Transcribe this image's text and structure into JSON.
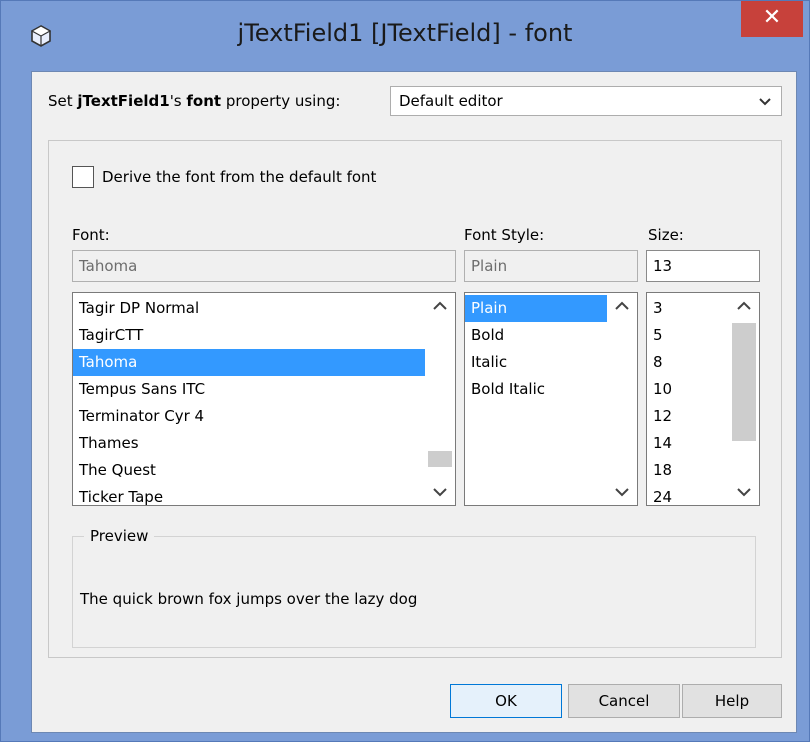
{
  "window": {
    "title": "jTextField1 [JTextField] - font",
    "close_glyph": "✕"
  },
  "property_row": {
    "prefix": "Set ",
    "component": "jTextField1",
    "apostrophe": "'s ",
    "property": "font",
    "suffix": " property using:",
    "editor_selected": "Default editor"
  },
  "derive_checkbox": {
    "label": "Derive the font from the default font",
    "checked": false
  },
  "font": {
    "label": "Font:",
    "field_value": "Tahoma",
    "items": [
      "Tagir DP Normal",
      "TagirCTT",
      "Tahoma",
      "Tempus Sans ITC",
      "Terminator Cyr 4",
      "Thames",
      "The Quest",
      "Ticker Tape"
    ],
    "selected": "Tahoma"
  },
  "style": {
    "label": "Font Style:",
    "field_value": "Plain",
    "items": [
      "Plain",
      "Bold",
      "Italic",
      "Bold Italic"
    ],
    "selected": "Plain"
  },
  "size": {
    "label": "Size:",
    "field_value": "13",
    "items": [
      "3",
      "5",
      "8",
      "10",
      "12",
      "14",
      "18",
      "24"
    ]
  },
  "preview": {
    "title": "Preview",
    "text": "The quick brown fox jumps over the lazy dog"
  },
  "buttons": {
    "ok": "OK",
    "cancel": "Cancel",
    "help": "Help"
  },
  "colors": {
    "title_bar": "#7a9cd6",
    "close_button": "#c7413b",
    "selection": "#3399ff",
    "default_button_border": "#0078d7"
  },
  "icons": {
    "app": "cube-icon",
    "dropdown": "chevron-down-icon",
    "scroll_up": "chevron-up-icon",
    "scroll_down": "chevron-down-icon"
  }
}
